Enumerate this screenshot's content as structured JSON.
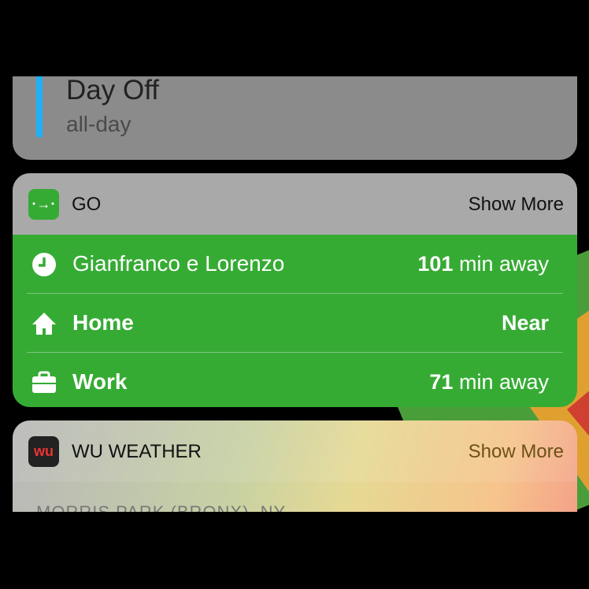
{
  "calendar": {
    "event_title": "Day Off",
    "event_time": "all-day",
    "accent": "#1fb0f5"
  },
  "go": {
    "app_name": "GO",
    "show_more": "Show More",
    "icon": "arrow-right-icon",
    "accent": "#36ab34",
    "rows": [
      {
        "icon": "clock-icon",
        "label": "Gianfranco e Lorenzo",
        "value_num": "101",
        "value_text": " min away"
      },
      {
        "icon": "home-icon",
        "label": "Home",
        "value_num": "Near",
        "value_text": ""
      },
      {
        "icon": "briefcase-icon",
        "label": "Work",
        "value_num": "71",
        "value_text": " min away"
      }
    ]
  },
  "weather": {
    "app_name": "WU WEATHER",
    "show_more": "Show More",
    "location": "MORRIS PARK (BRONX), NY"
  }
}
